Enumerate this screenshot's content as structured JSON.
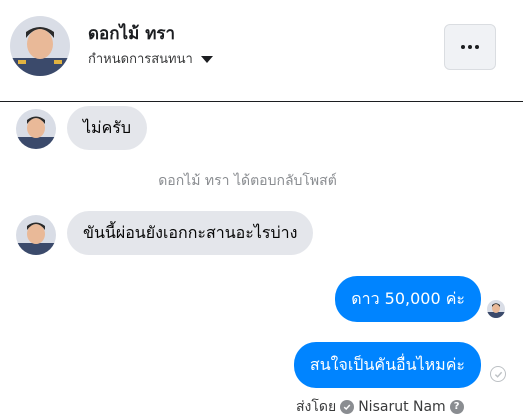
{
  "header": {
    "name": "ดอกไม้ ทรา",
    "subtitle": "กำหนดการสนทนา",
    "more_icon": "more-horizontal-icon"
  },
  "messages": [
    {
      "direction": "incoming",
      "text": "ไม่ครับ"
    },
    {
      "direction": "system",
      "text": "ดอกไม้ ทรา ได้ตอบกลับโพสต์"
    },
    {
      "direction": "incoming",
      "text": "ขันนี้ผ่อนยังเอกกะสานอะไรบ่าง"
    },
    {
      "direction": "outgoing",
      "text": "ดาว 50,000 ค่ะ"
    },
    {
      "direction": "outgoing",
      "text": "สนใจเป็นคันอื่นไหมค่ะ"
    }
  ],
  "footer": {
    "sent_by_label": "ส่งโดย",
    "author": "Nisarut Nam",
    "help_glyph": "?"
  },
  "colors": {
    "outgoing_bubble": "#0084ff",
    "incoming_bubble": "#e4e6eb",
    "system_text": "#8a8d91"
  }
}
